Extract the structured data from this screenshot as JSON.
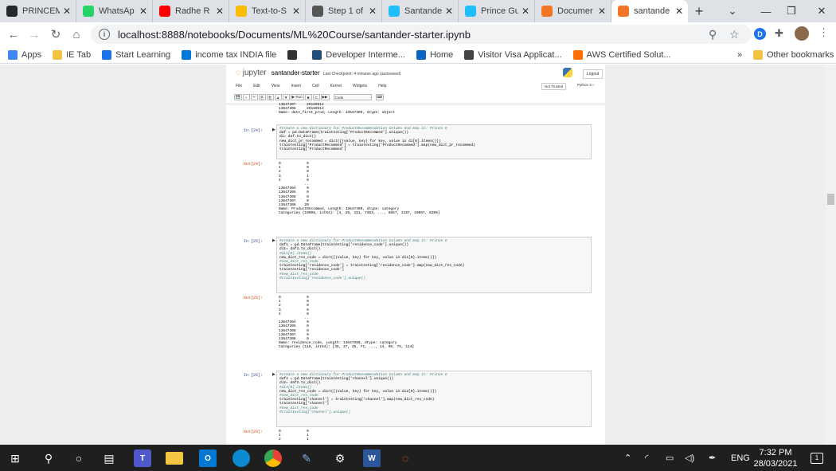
{
  "browser": {
    "tabs": [
      {
        "label": "PRINCEM",
        "color": "#24292e",
        "icon": "github-icon"
      },
      {
        "label": "WhatsAp",
        "color": "#25d366",
        "icon": "whatsapp-icon"
      },
      {
        "label": "Radhe R",
        "color": "#ff0000",
        "icon": "youtube-icon"
      },
      {
        "label": "Text-to-S",
        "color": "#fbbc05",
        "icon": "drive-icon"
      },
      {
        "label": "Step 1 of",
        "color": "#555555",
        "icon": "gear-icon"
      },
      {
        "label": "Santande",
        "color": "#20beff",
        "icon": "kaggle-icon"
      },
      {
        "label": "Prince Gu",
        "color": "#20beff",
        "icon": "kaggle-icon"
      },
      {
        "label": "Documer",
        "color": "#f37626",
        "icon": "jupyter-icon"
      },
      {
        "label": "santande",
        "color": "#f37626",
        "icon": "jupyter-notebook-icon"
      }
    ],
    "new_tab": "+",
    "url": "localhost:8888/notebooks/Documents/ML%20Course/santander-starter.ipynb",
    "profile_initial": "D",
    "bookmarks": [
      {
        "label": "Apps",
        "color": "#4285f4"
      },
      {
        "label": "IE Tab",
        "color": "#f4c542"
      },
      {
        "label": "Start Learning",
        "color": "#1a73e8"
      },
      {
        "label": "income tax INDIA file",
        "color": "#0078d7"
      },
      {
        "label": "",
        "color": "#333333"
      },
      {
        "label": "Developer Interme...",
        "color": "#1f4e79"
      },
      {
        "label": "Home",
        "color": "#0a66c2"
      },
      {
        "label": "Visitor Visa Applicat...",
        "color": "#444444"
      },
      {
        "label": "AWS Certified Solut...",
        "color": "#ff6f00"
      }
    ],
    "more_bookmarks": "»",
    "other_bookmarks": "Other bookmarks"
  },
  "jupyter": {
    "logo": "jupyter",
    "notebook_name": "santander-starter",
    "checkpoint": "Last Checkpoint: 4 minutes ago  (autosaved)",
    "logout": "Logout",
    "menus": [
      "File",
      "Edit",
      "View",
      "Insert",
      "Cell",
      "Kernel",
      "Widgets",
      "Help"
    ],
    "trusted": "Not Trusted",
    "kernel": "Python 3",
    "toolbar": [
      "💾",
      "+",
      "✂",
      "⎘",
      "⎗",
      "▲",
      "▼",
      "▶ Run",
      "■",
      "C",
      "▶▶"
    ],
    "cell_type": "Code"
  },
  "cells": {
    "top_output": "13647307     20180614\n13647308     20160513\nName: date_first_prod, Length: 13647309, dtype: object",
    "c24": {
      "in": "In [24]:",
      "out": "Out[24]:",
      "code": [
        "#create a new dictionary for ProductRecommendation Column and map it: Prince G",
        "daf = pd.DataFrame(traintesting['ProductRecommed'].unique())",
        "di= daf.to_dict()",
        "new_dict_pr_recommed = dict([(value, key) for key, value in di[0].items()])",
        "traintesting['ProductRecommed'] = traintesting['ProductRecommed'].map(new_dict_pr_recommed)",
        "traintesting['ProductRecommed']"
      ],
      "output": "0            0\n1            0\n2            0\n3            1\n4            0\n            ..\n13647304     0\n13647305     0\n13647306     0\n13647307     0\n13647308    20\nName: ProductRecommed, Length: 13647309, dtype: category\nCategories (10908, int64): [4, 26, 151, 7383, ..., 6857, 3187, 10067, 8209]"
    },
    "c25": {
      "in": "In [25]:",
      "out": "Out[25]:",
      "code": [
        "#create a new dictionary for ProductRecommendation Column and map it: Prince G",
        "daf1 = pd.DataFrame(traintesting['residence_code'].unique())",
        "di1= daf1.to_dict()",
        "#di1[0].items()",
        "new_dict_res_code = dict([(value, key) for key, value in di1[0].items()])",
        "#new_dict_res_code",
        "traintesting['residence_code'] = traintesting['residence_code'].map(new_dict_res_code)",
        "traintesting['residence_code']",
        "#new_dict_res_code",
        "#traintesting['residence_code'].unique()"
      ],
      "output": "0            0\n1            0\n2            0\n3            0\n4            0\n            ..\n13647304     0\n13647305     0\n13647306     0\n13647307     0\n13647308     0\nName: residence_code, Length: 13647309, dtype: category\nCategories (118, int64): [35, 37, 25, 71, ..., 14, 90, 75, 114]"
    },
    "c26": {
      "in": "In [26]:",
      "out": "Out[26]:",
      "code": [
        "#create a new dictionary for ProductRecommendation Column and map it: Prince G",
        "daf2 = pd.DataFrame(traintesting['channel'].unique())",
        "di2= daf2.to_dict()",
        "#di2[0].items()",
        "new_dict_res_code = dict([(value, key) for key, value in di2[0].items()])",
        "#new_dict_res_code",
        "traintesting['channel'] = traintesting['channel'].map(new_dict_res_code)",
        "traintesting['channel']",
        "#new_dict_res_code",
        "#traintesting['channel'].unique()"
      ],
      "output": "0            0\n1            1\n2            1"
    }
  },
  "taskbar": {
    "lang": "ENG",
    "time": "7:32 PM",
    "date": "28/03/2021",
    "notifications": "1"
  }
}
